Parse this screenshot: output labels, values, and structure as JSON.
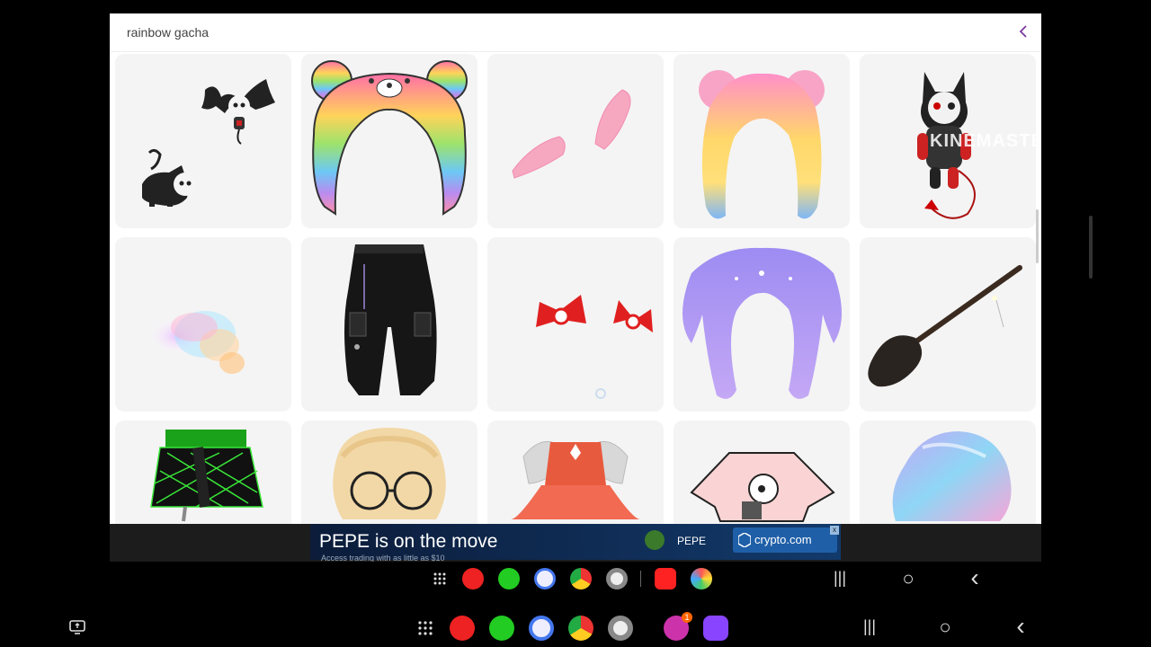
{
  "search": {
    "query": "rainbow gacha"
  },
  "ad": {
    "title": "PEPE is on the move",
    "subtitle": "Access trading with as little as $10",
    "token_label": "PEPE",
    "brand": "crypto.com"
  },
  "watermark": "KINEMASTER",
  "nav_glyphs": {
    "recents": "|||",
    "home": "○",
    "back": "‹"
  },
  "notification_badge": "1",
  "items": [
    {
      "name": "bat and cat pets"
    },
    {
      "name": "rainbow bear hood"
    },
    {
      "name": "pink ears"
    },
    {
      "name": "pastel rainbow hair"
    },
    {
      "name": "devil cat plush"
    },
    {
      "name": "pastel cloud"
    },
    {
      "name": "black cargo pants"
    },
    {
      "name": "red bows"
    },
    {
      "name": "purple pigtail hair"
    },
    {
      "name": "witch broom"
    },
    {
      "name": "neon green skirt"
    },
    {
      "name": "blonde hair with glasses"
    },
    {
      "name": "red dress"
    },
    {
      "name": "pink crop top"
    },
    {
      "name": "holographic hair"
    }
  ]
}
